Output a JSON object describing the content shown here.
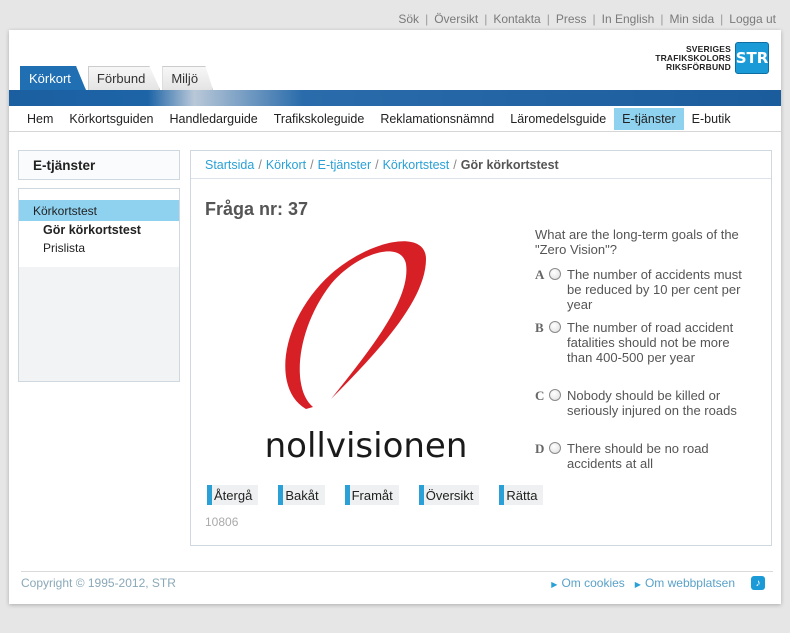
{
  "top_links": [
    "Sök",
    "Översikt",
    "Kontakta",
    "Press",
    "In English",
    "Min sida",
    "Logga ut"
  ],
  "logo": {
    "line1": "SVERIGES",
    "line2": "TRAFIKSKOLORS",
    "line3": "RIKSFÖRBUND",
    "mark": "STR"
  },
  "tabs": [
    "Körkort",
    "Förbund",
    "Miljö"
  ],
  "nav": [
    "Hem",
    "Körkortsguiden",
    "Handledarguide",
    "Trafikskoleguide",
    "Reklamationsnämnd",
    "Läromedelsguide",
    "E-tjänster",
    "E-butik"
  ],
  "sidebar": {
    "title": "E-tjänster",
    "active": "Körkortstest",
    "items": [
      "Gör körkortstest",
      "Prislista"
    ]
  },
  "breadcrumb": [
    "Startsida",
    "Körkort",
    "E-tjänster",
    "Körkortstest"
  ],
  "breadcrumb_current": "Gör körkortstest",
  "question": {
    "title": "Fråga nr: 37",
    "image_text": "nollvisionen",
    "text": "What are the long-term goals of the \"Zero Vision\"?",
    "answers": [
      {
        "letter": "A",
        "text": "The number of accidents must be reduced by 10 per cent per year"
      },
      {
        "letter": "B",
        "text": "The number of road accident fatalities should not be more than 400-500 per year"
      },
      {
        "letter": "C",
        "text": "Nobody should be killed or seriously injured on the roads"
      },
      {
        "letter": "D",
        "text": "There should be no road accidents at all"
      }
    ]
  },
  "buttons": [
    "Återgå",
    "Bakåt",
    "Framåt",
    "Översikt",
    "Rätta"
  ],
  "code": "10806",
  "footer": {
    "copyright": "Copyright © 1995-2012, STR",
    "links": [
      "Om cookies",
      "Om webbplatsen"
    ]
  }
}
